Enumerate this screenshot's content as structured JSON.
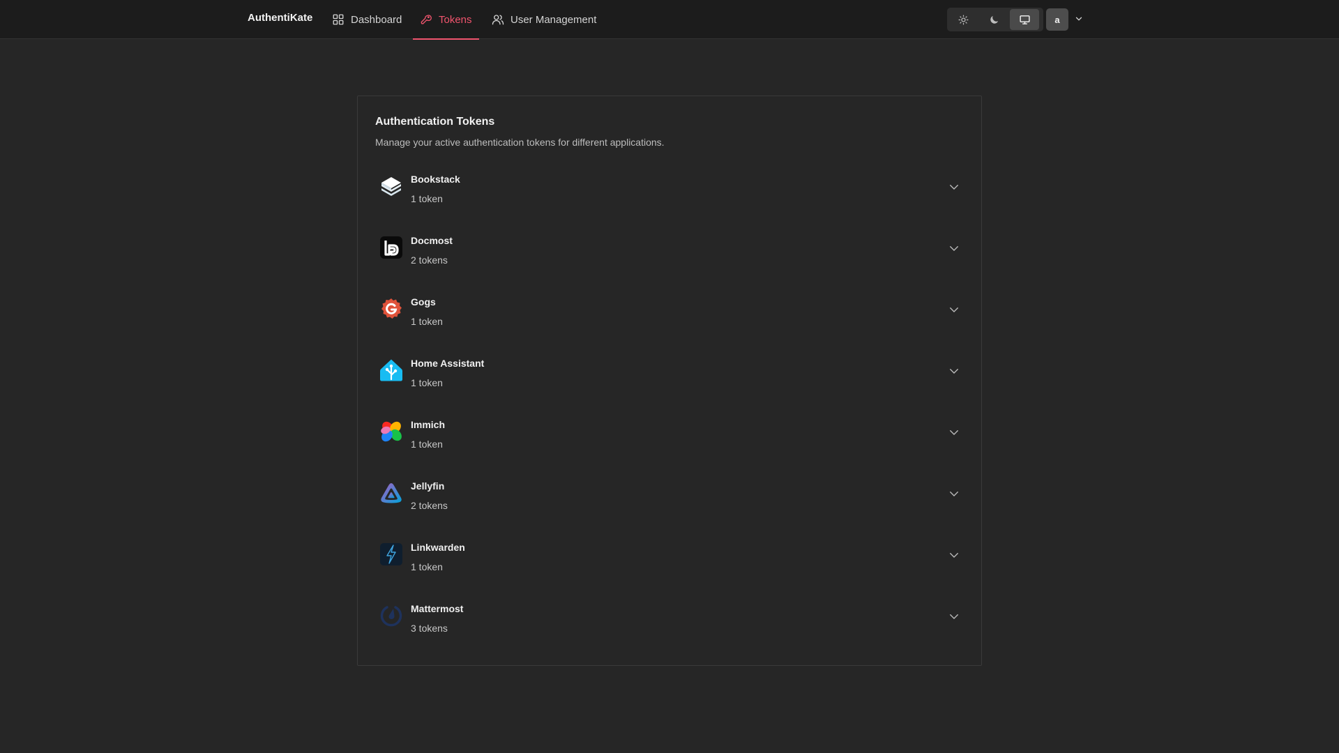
{
  "nav": {
    "brand": "AuthentiKate",
    "items": [
      {
        "label": "Dashboard",
        "icon": "grid-icon"
      },
      {
        "label": "Tokens",
        "icon": "key-icon",
        "active": true
      },
      {
        "label": "User Management",
        "icon": "users-icon"
      }
    ],
    "theme": {
      "options": [
        "light",
        "dark",
        "system"
      ],
      "selected": "system"
    },
    "user_initial": "a"
  },
  "colors": {
    "accent": "#f0546d",
    "background": "#262626",
    "topbar": "#1c1c1c"
  },
  "card": {
    "title": "Authentication Tokens",
    "description": "Manage your active authentication tokens for different applications.",
    "apps": [
      {
        "name": "Bookstack",
        "count": "1 token",
        "icon": "bookstack-icon"
      },
      {
        "name": "Docmost",
        "count": "2 tokens",
        "icon": "docmost-icon"
      },
      {
        "name": "Gogs",
        "count": "1 token",
        "icon": "gogs-icon"
      },
      {
        "name": "Home Assistant",
        "count": "1 token",
        "icon": "home-assistant-icon"
      },
      {
        "name": "Immich",
        "count": "1 token",
        "icon": "immich-icon"
      },
      {
        "name": "Jellyfin",
        "count": "2 tokens",
        "icon": "jellyfin-icon"
      },
      {
        "name": "Linkwarden",
        "count": "1 token",
        "icon": "linkwarden-icon"
      },
      {
        "name": "Mattermost",
        "count": "3 tokens",
        "icon": "mattermost-icon"
      }
    ]
  }
}
